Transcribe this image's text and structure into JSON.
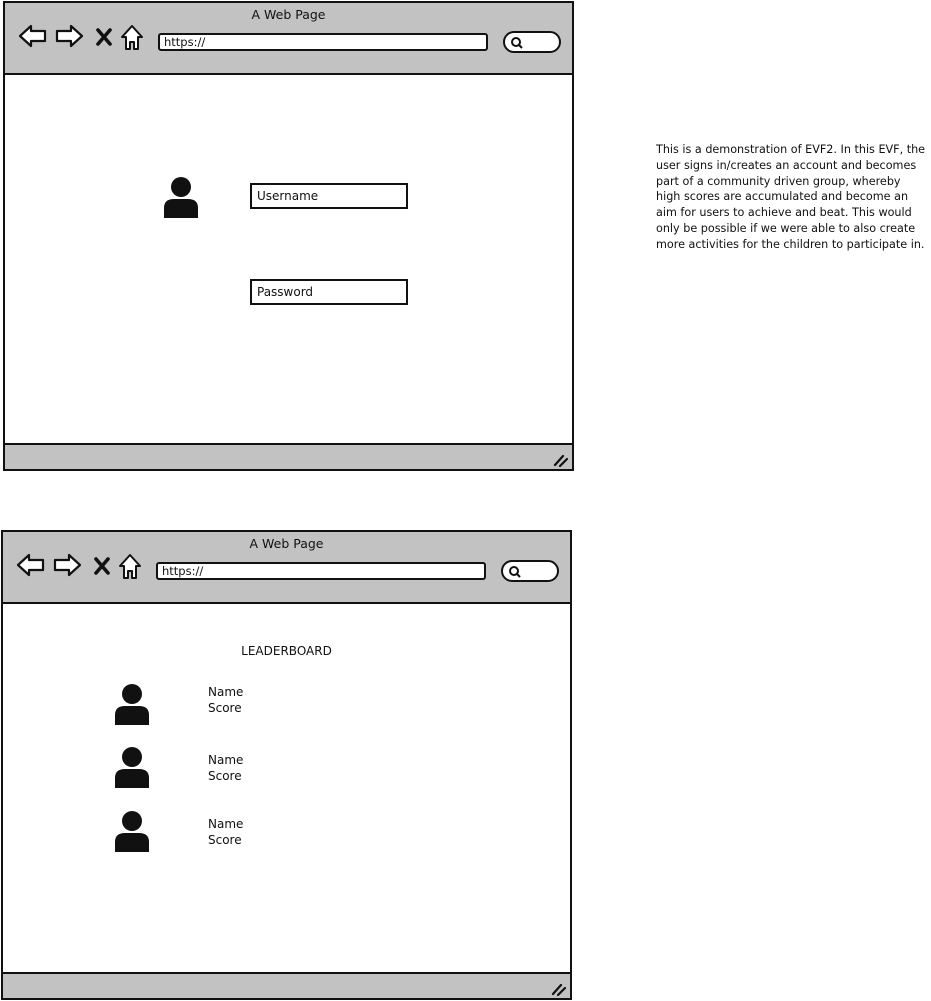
{
  "login_window": {
    "title": "A Web Page",
    "url": "https://",
    "username_field": {
      "text": "Username"
    },
    "password_field": {
      "text": "Password"
    }
  },
  "leaderboard_window": {
    "title": "A Web Page",
    "url": "https://",
    "heading": "LEADERBOARD",
    "entries": [
      {
        "name": "Name",
        "score": "Score"
      },
      {
        "name": "Name",
        "score": "Score"
      },
      {
        "name": "Name",
        "score": "Score"
      }
    ]
  },
  "annotation": {
    "text": "This is a demonstration of EVF2. In this EVF, the user signs in/creates an account and becomes part of a community driven group, whereby high scores are accumulated and become an aim for users to achieve and beat. This would only be possible if we were able to also create more activities for the children to participate in."
  },
  "icons": [
    "back-arrow-icon",
    "forward-arrow-icon",
    "close-icon",
    "home-icon",
    "search-icon",
    "user-icon",
    "resize-grip-icon"
  ],
  "colors": {
    "chrome": "#c2c2c2",
    "stroke": "#111111",
    "background": "#ffffff"
  }
}
